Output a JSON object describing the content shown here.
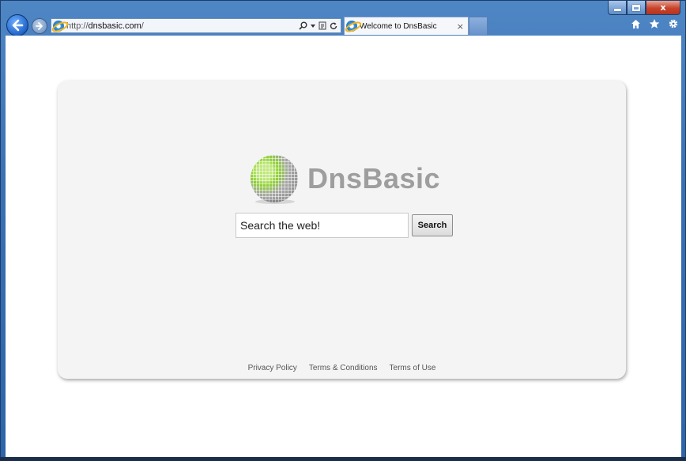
{
  "browser": {
    "url_prefix": "http://",
    "url_domain": "dnsbasic.com",
    "url_suffix": "/",
    "tab_title": "Welcome to DnsBasic",
    "tab_close": "×",
    "window_close": "x"
  },
  "page": {
    "brand": "DnsBasic",
    "search_value": "Search the web!",
    "search_button": "Search",
    "footer": {
      "privacy": "Privacy Policy",
      "terms_conditions": "Terms & Conditions",
      "terms_use": "Terms of Use"
    }
  },
  "colors": {
    "brand_text": "#9e9e9e",
    "globe_green": "#8fd132",
    "globe_gray": "#a7a7a7"
  }
}
